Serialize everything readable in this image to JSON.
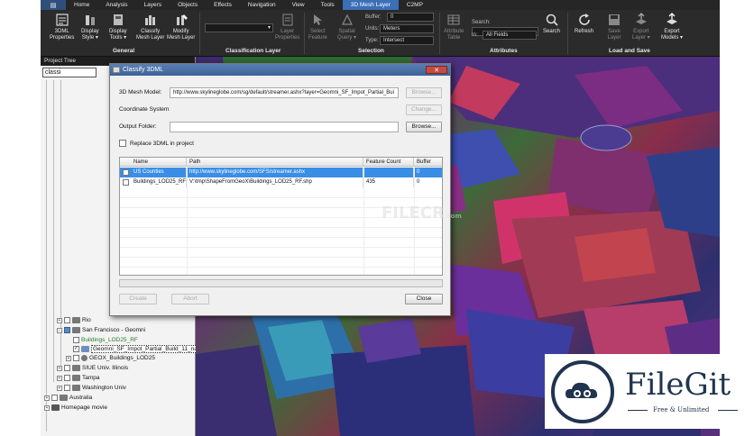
{
  "menu": {
    "app_button": "▤",
    "tabs": [
      "Home",
      "Analysis",
      "Layers",
      "Objects",
      "Effects",
      "Navigation",
      "View",
      "Tools",
      "3D Mesh Layer",
      "C2MP"
    ],
    "active_tab": "3D Mesh Layer",
    "accent_color": "#3b6fb6"
  },
  "ribbon": {
    "general": {
      "label": "General",
      "buttons": [
        {
          "label": "3DML\nProperties",
          "icon": "properties-icon"
        },
        {
          "label": "Display\nStyle ▾",
          "icon": "display-style-icon"
        },
        {
          "label": "Display\nTools ▾",
          "icon": "display-tools-icon"
        },
        {
          "label": "Classify\nMesh Layer",
          "icon": "classify-icon"
        },
        {
          "label": "Modify\nMesh Layer",
          "icon": "modify-icon"
        }
      ]
    },
    "classification": {
      "label": "Classification Layer",
      "layer_properties": "Layer\nProperties"
    },
    "selection": {
      "label": "Selection",
      "select_feature": "Select\nFeature",
      "spatial_query": "Spatial\nQuery ▾",
      "buffer_label": "Buffer:",
      "buffer_value": "0",
      "units_label": "Units:",
      "units_value": "Meters",
      "type_label": "Type:",
      "type_value": "Intersect"
    },
    "attributes": {
      "label": "Attributes",
      "attribute_table": "Attribute\nTable",
      "search_label": "Search:",
      "in_label": "In:",
      "in_value": "All Fields",
      "search_button": "Search"
    },
    "load_save": {
      "label": "Load and Save",
      "buttons": [
        "Refresh",
        "Save\nLayer",
        "Export\nLayer ▾",
        "Export\nModels ▾"
      ]
    }
  },
  "tree": {
    "header": "Project Tree",
    "search_value": "classi",
    "items": [
      {
        "label": "Rio",
        "level": 1
      },
      {
        "label": "San Francisco - Geomni",
        "level": 1
      },
      {
        "label": "Buildings_LOD25_RF",
        "level": 2,
        "link": true
      },
      {
        "label": "Geomni_SF_Impot_Partial_Build_11_na",
        "level": 2,
        "selected": true
      },
      {
        "label": "GEOX_Buildings_LOD25",
        "level": 2
      },
      {
        "label": "SIUE Univ. Illinois",
        "level": 1
      },
      {
        "label": "Tampa",
        "level": 1
      },
      {
        "label": "Washington Univ",
        "level": 1
      },
      {
        "label": "Australia",
        "level": 0
      },
      {
        "label": "Homepage movie",
        "level": 0
      }
    ]
  },
  "dialog": {
    "title": "Classify 3DML",
    "close": "✕",
    "mesh_model_label": "3D Mesh Model:",
    "mesh_model_value": "http://www.skylineglobe.com/sg/default/streamer.ashx?layer=Geomni_SF_Impot_Partial_Bui",
    "coord_label": "Coordinate System:",
    "coord_value": "",
    "output_label": "Output Folder:",
    "output_value": "",
    "browse1": "Browse...",
    "change": "Change...",
    "browse2": "Browse...",
    "replace_label": "Replace 3DML in project",
    "columns": [
      "Name",
      "Path",
      "Feature Count",
      "Buffer"
    ],
    "rows": [
      {
        "name": "US Counties",
        "path": "http://www.skylineglobe.com/SFS/streamer.ashx",
        "count": "",
        "buffer": "0"
      },
      {
        "name": "Buildings_LOD25_RF",
        "path": "V:\\tmp\\ShapeFromGeoX\\Buildings_LOD25_RF.shp",
        "count": "435",
        "buffer": "0"
      }
    ],
    "create": "Create",
    "abort": "Abort",
    "close_btn": "Close"
  },
  "watermarks": {
    "filecr": "FILECR",
    "filecr_sub": ".com",
    "filegit_name": "FileGit",
    "filegit_tag": "Free & Unlimited"
  }
}
